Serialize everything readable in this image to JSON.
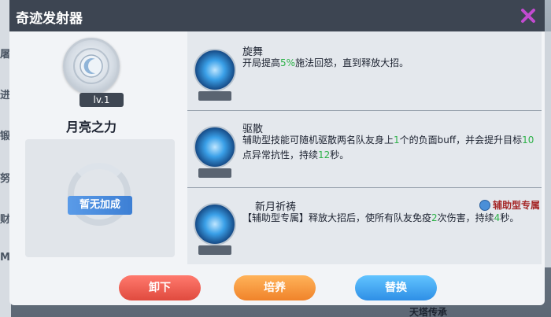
{
  "window": {
    "title": "奇迹发射器",
    "close_icon": "close-icon"
  },
  "background": {
    "side_chars": [
      "屠",
      "进",
      "锻",
      "努",
      "财",
      "M"
    ],
    "bottom_text": "天塔传承"
  },
  "item": {
    "level": "lv.1",
    "name": "月亮之力",
    "emblem_icon": "moon-emblem-icon"
  },
  "bonus": {
    "label": "暂无加成"
  },
  "skills": [
    {
      "name": "旋舞",
      "desc_parts": [
        "开局提高",
        "5%",
        "施法回怒，直到释放大招。"
      ],
      "icon": "whirl-dance-icon"
    },
    {
      "name": "驱散",
      "desc_parts": [
        "辅助型技能可随机驱散两名队友身上",
        "1",
        "个的负面buff，并会提升目标",
        "10",
        "点异常抗性，持续",
        "12",
        "秒。"
      ],
      "icon": "dispel-icon"
    },
    {
      "name": "新月祈祷",
      "desc_parts": [
        "【辅助型专属】释放大招后，使所有队友免疫",
        "2",
        "次伤害，持续",
        "4",
        "秒。"
      ],
      "icon": "crescent-prayer-icon",
      "tag": "辅助型专属",
      "tag_icon": "support-type-icon"
    }
  ],
  "buttons": {
    "unequip": "卸下",
    "train": "培养",
    "replace": "替换"
  },
  "colors": {
    "highlight": "#2fb24a",
    "titlebar": "#3d4552",
    "close": "#c24bd0",
    "tag": "#a52828"
  }
}
